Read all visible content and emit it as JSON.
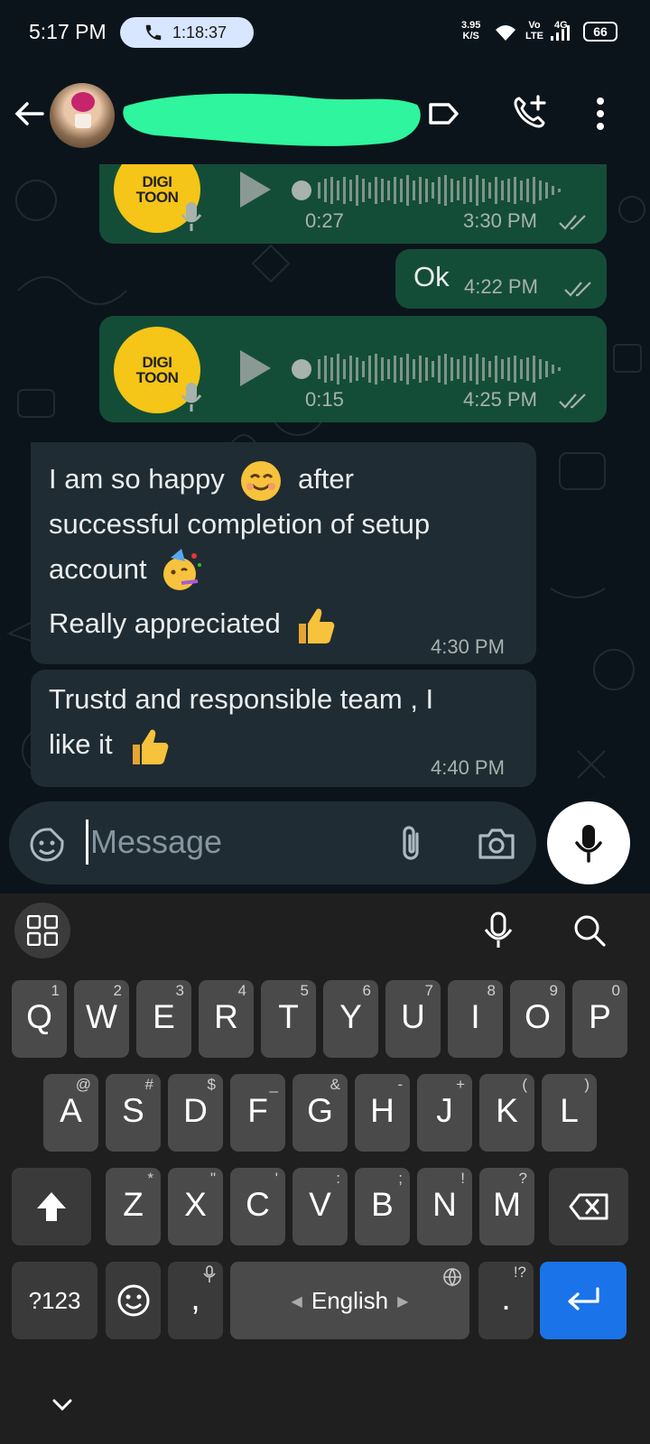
{
  "status_bar": {
    "time": "5:17 PM",
    "call_timer": "1:18:37",
    "net_speed_value": "3.95",
    "net_speed_unit": "K/S",
    "volte_top": "Vo",
    "volte_bottom": "LTE",
    "network": "4G",
    "battery": "66"
  },
  "header": {
    "icons": [
      "back-arrow-icon",
      "avatar",
      "label-tag-icon",
      "add-call-icon",
      "more-vert-icon"
    ]
  },
  "messages": [
    {
      "type": "voice",
      "direction": "outgoing",
      "logo_line1": "DIGI",
      "logo_line2": "TOON",
      "duration": "0:27",
      "time": "3:30 PM"
    },
    {
      "type": "text",
      "direction": "outgoing",
      "text": "Ok",
      "time": "4:22 PM"
    },
    {
      "type": "voice",
      "direction": "outgoing",
      "logo_line1": "DIGI",
      "logo_line2": "TOON",
      "duration": "0:15",
      "time": "4:25 PM"
    },
    {
      "type": "text",
      "direction": "incoming",
      "lines": [
        "I am so happy",
        "after",
        "successful completion of setup",
        "account",
        "Really appreciated"
      ],
      "time": "4:30 PM"
    },
    {
      "type": "text",
      "direction": "incoming",
      "lines": [
        "Trustd and responsible team , I",
        "like it"
      ],
      "time": "4:40 PM"
    }
  ],
  "composer": {
    "placeholder": "Message"
  },
  "keyboard": {
    "row1": [
      {
        "k": "Q",
        "h": "1"
      },
      {
        "k": "W",
        "h": "2"
      },
      {
        "k": "E",
        "h": "3"
      },
      {
        "k": "R",
        "h": "4"
      },
      {
        "k": "T",
        "h": "5"
      },
      {
        "k": "Y",
        "h": "6"
      },
      {
        "k": "U",
        "h": "7"
      },
      {
        "k": "I",
        "h": "8"
      },
      {
        "k": "O",
        "h": "9"
      },
      {
        "k": "P",
        "h": "0"
      }
    ],
    "row2": [
      {
        "k": "A",
        "h": "@"
      },
      {
        "k": "S",
        "h": "#"
      },
      {
        "k": "D",
        "h": "$"
      },
      {
        "k": "F",
        "h": "_"
      },
      {
        "k": "G",
        "h": "&"
      },
      {
        "k": "H",
        "h": "-"
      },
      {
        "k": "J",
        "h": "+"
      },
      {
        "k": "K",
        "h": "("
      },
      {
        "k": "L",
        "h": ")"
      }
    ],
    "row3": [
      {
        "k": "Z",
        "h": "*"
      },
      {
        "k": "X",
        "h": "\""
      },
      {
        "k": "C",
        "h": "'"
      },
      {
        "k": "V",
        "h": ":"
      },
      {
        "k": "B",
        "h": ";"
      },
      {
        "k": "N",
        "h": "!"
      },
      {
        "k": "M",
        "h": "?"
      }
    ],
    "symbols_label": "?123",
    "comma": ",",
    "space_label": "English",
    "period": ".",
    "period_hint": "!?"
  },
  "colors": {
    "background": "#0b141a",
    "outgoing_bubble": "#144d37",
    "incoming_bubble": "#202c33",
    "accent_green": "#2ef59e",
    "enter_key": "#1a73e8"
  }
}
